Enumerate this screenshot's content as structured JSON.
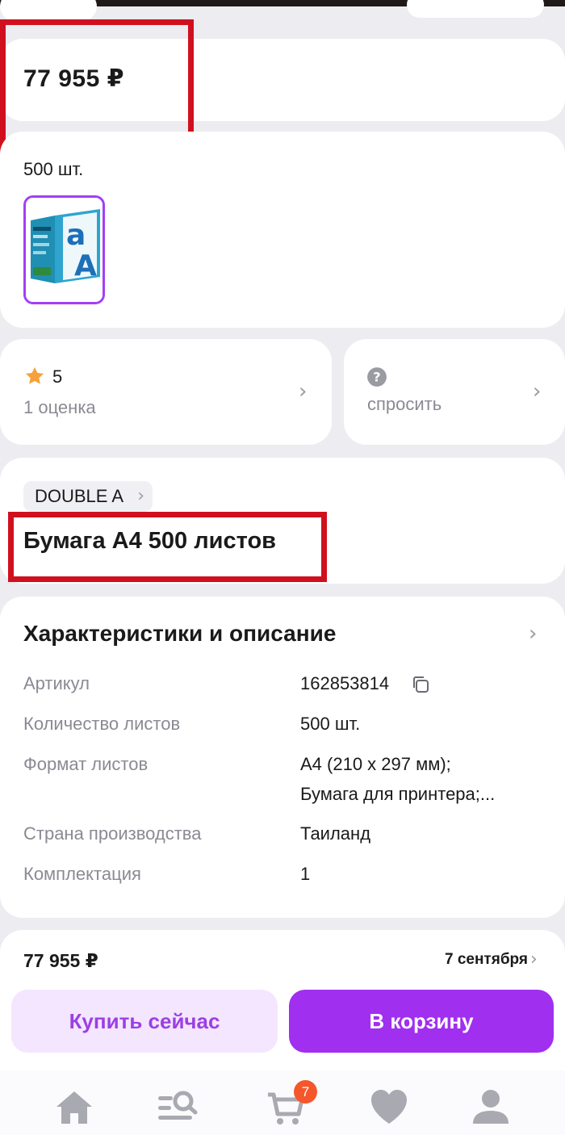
{
  "product": {
    "price": "77 955 ₽",
    "variant_label": "500 шт.",
    "rating_value": "5",
    "rating_count": "1 оценка",
    "ask_label": "спросить",
    "brand": "DOUBLE A",
    "title": "Бумага А4 500 листов"
  },
  "specs": {
    "title": "Характеристики и описание",
    "rows": [
      {
        "key": "Артикул",
        "value": "162853814"
      },
      {
        "key": "Количество листов",
        "value": "500 шт."
      },
      {
        "key": "Формат листов",
        "value": "А4 (210 x 297 мм);",
        "value2": "Бумага для принтера;..."
      },
      {
        "key": "Страна производства",
        "value": "Таиланд"
      },
      {
        "key": "Комплектация",
        "value": "1"
      }
    ]
  },
  "buy_bar": {
    "price": "77 955 ₽",
    "delivery": "7 сентября",
    "buy_now_label": "Купить сейчас",
    "add_to_cart_label": "В корзину"
  },
  "nav": {
    "items": [
      "home-icon",
      "catalog-search-icon",
      "cart-icon",
      "favorites-heart-icon",
      "profile-icon"
    ],
    "cart_badge": "7"
  },
  "colors": {
    "accent": "#a02ff0",
    "accent_light": "#f4e6fe",
    "highlight_box": "#d0101e",
    "badge": "#f4572b",
    "star": "#f6a23a"
  }
}
